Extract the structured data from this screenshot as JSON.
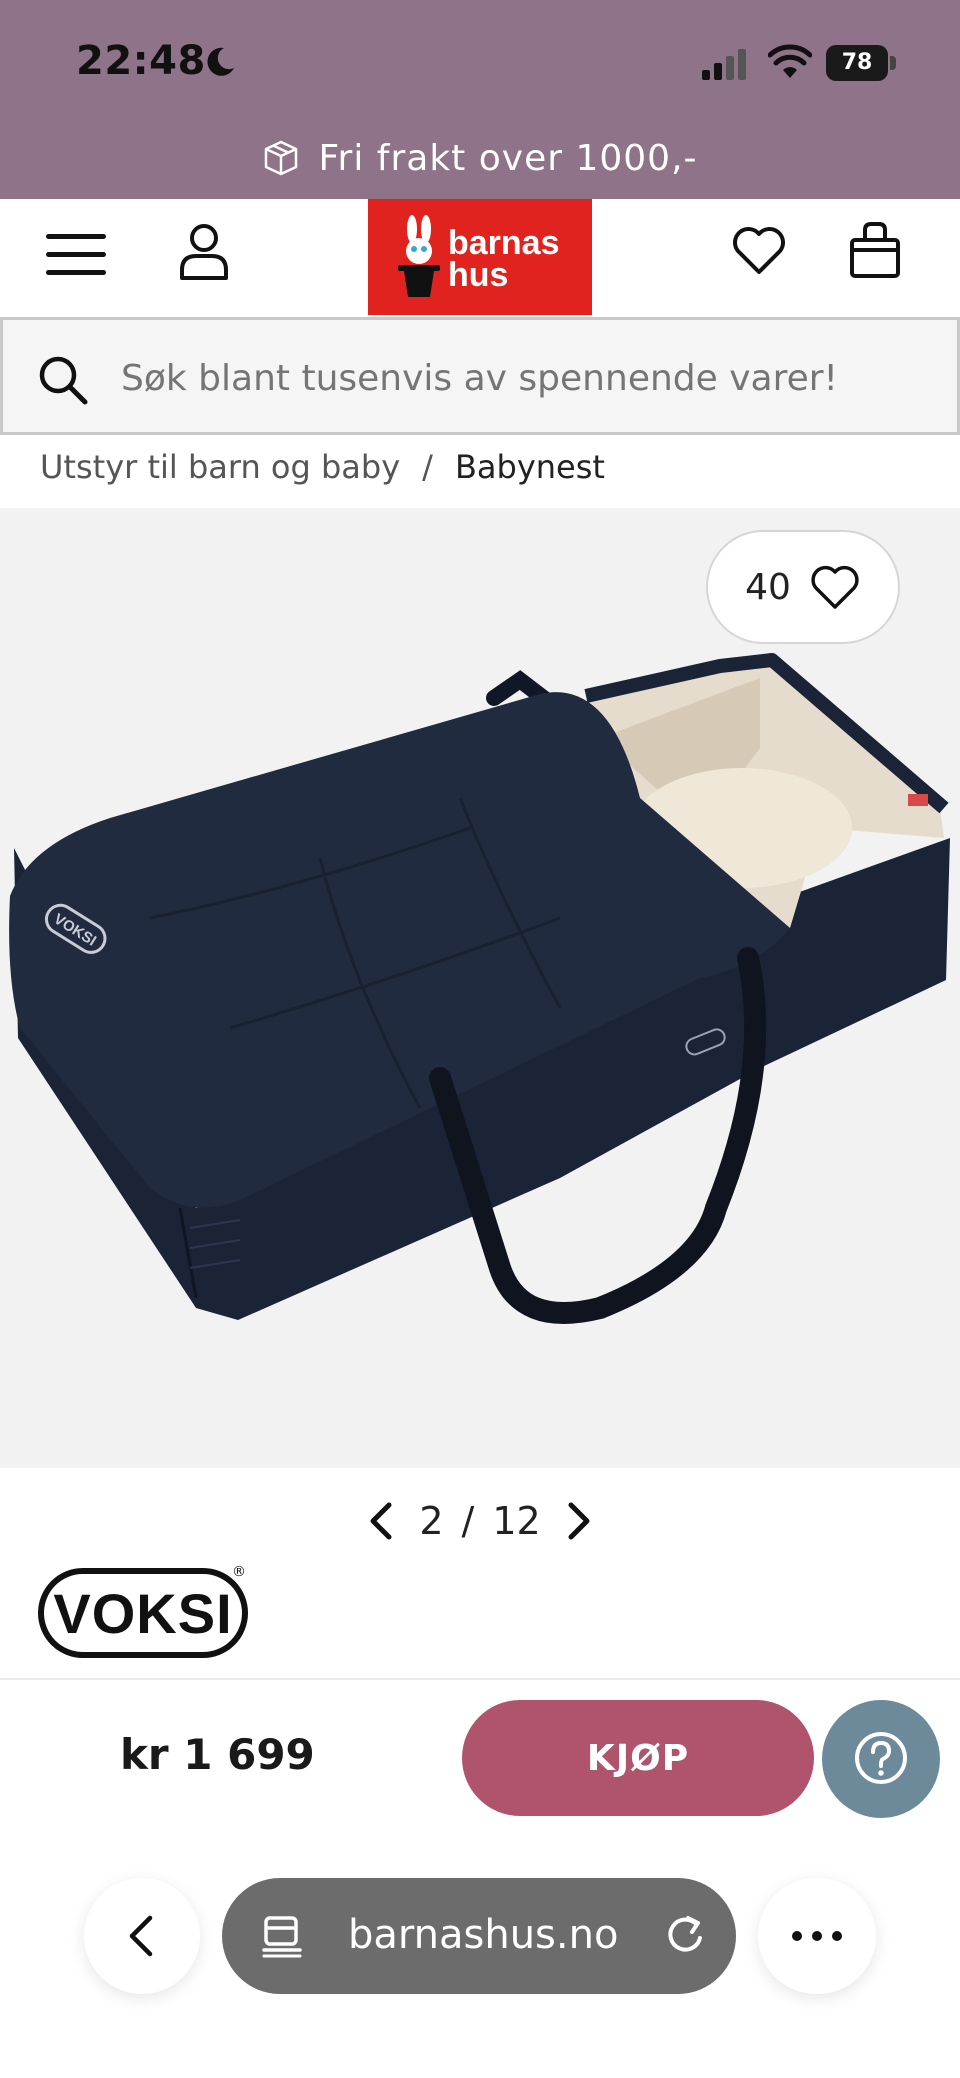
{
  "status_bar": {
    "time": "22:48",
    "battery": "78"
  },
  "promo": {
    "text": "Fri frakt over 1000,-"
  },
  "header": {
    "logo_line1": "barnas",
    "logo_line2": "hus"
  },
  "search": {
    "placeholder": "Søk blant tusenvis av spennende varer!"
  },
  "breadcrumb": {
    "parent": "Utstyr til barn og baby",
    "separator": "/",
    "current": "Babynest"
  },
  "product": {
    "favorites_count": "40",
    "image_brand_mark": "VOKSI",
    "pager": {
      "current": "2",
      "separator": "/",
      "total": "12"
    },
    "brand": "VOKSI",
    "brand_reg": "®",
    "price": "kr 1 699"
  },
  "actions": {
    "buy_label": "KJØP"
  },
  "browser": {
    "url": "barnashus.no"
  },
  "colors": {
    "promo_bg": "#8f7388",
    "logo_red": "#e1231f",
    "buy_button": "#b0546e",
    "help_button": "#6c8a9a",
    "url_bar": "#6c6c6c"
  },
  "icons": [
    "moon-icon",
    "signal-icon",
    "wifi-icon",
    "battery-icon",
    "package-icon",
    "menu-icon",
    "user-icon",
    "heart-icon",
    "shopping-bag-icon",
    "search-icon",
    "chevron-left-icon",
    "chevron-right-icon",
    "question-icon",
    "tabs-icon",
    "reload-icon",
    "more-icon"
  ]
}
